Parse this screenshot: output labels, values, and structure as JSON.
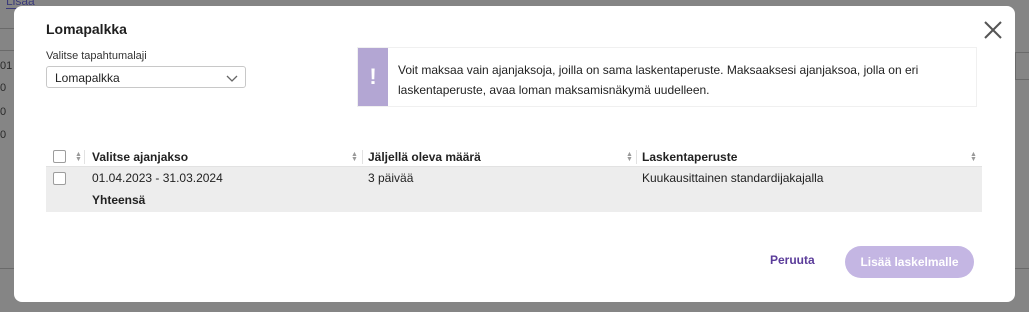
{
  "background": {
    "link_text": "Lisää",
    "row_numbers": [
      "01",
      "0",
      "0",
      "0"
    ]
  },
  "modal": {
    "title": "Lomapalkka",
    "close_icon": "close-icon"
  },
  "event_type": {
    "label": "Valitse tapahtumalaji",
    "selected": "Lomapalkka"
  },
  "notice": {
    "icon": "!",
    "text": "Voit maksaa vain ajanjaksoja, joilla on sama laskentaperuste. Maksaaksesi ajanjaksoa, jolla on eri laskentaperuste, avaa loman maksamisnäkymä uudelleen."
  },
  "table": {
    "columns": [
      "Valitse ajanjakso",
      "Jäljellä oleva määrä",
      "Laskentaperuste"
    ],
    "rows": [
      {
        "period": "01.04.2023 - 31.03.2024",
        "remaining": "3 päivää",
        "basis": "Kuukausittainen standardijakajalla"
      }
    ],
    "total_label": "Yhteensä"
  },
  "footer": {
    "cancel_label": "Peruuta",
    "add_label": "Lisää laskelmalle"
  },
  "colors": {
    "accent": "#5b3c9a",
    "notice_bar": "#b3a6d3",
    "primary_disabled": "#c4b6e3"
  }
}
